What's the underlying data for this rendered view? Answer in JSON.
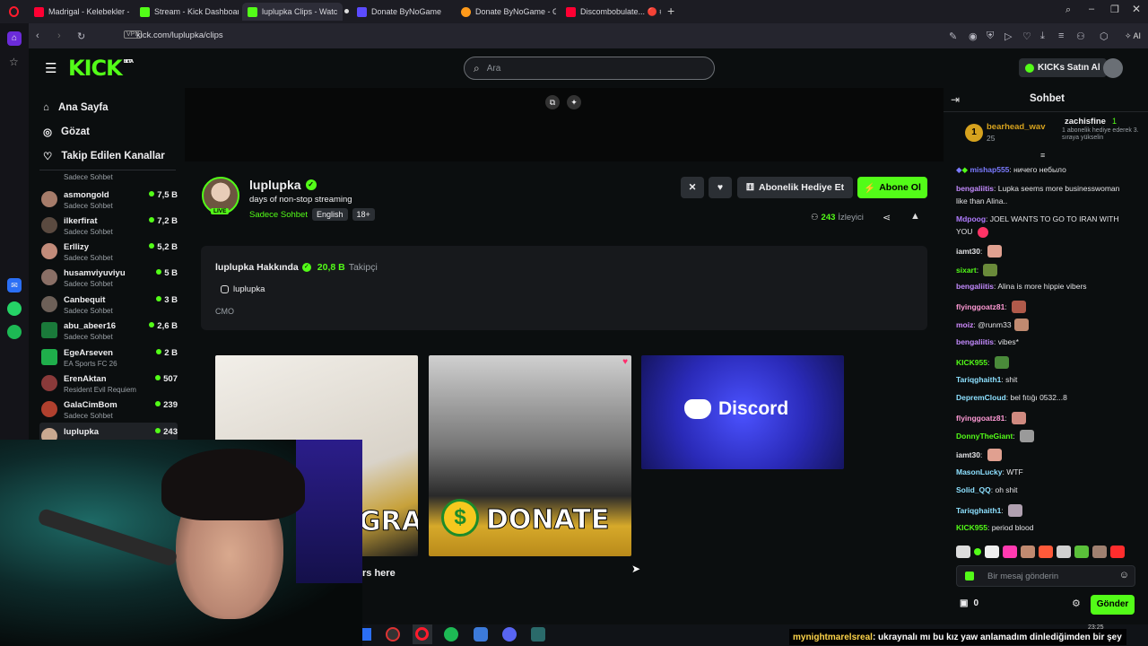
{
  "browser": {
    "tabs": [
      {
        "label": "Madrigal - Kelebekler - Yo",
        "icon": "youtube-icon",
        "color": "#ff0033"
      },
      {
        "label": "Stream - Kick Dashboard",
        "icon": "kick-icon",
        "color": "#53fc18"
      },
      {
        "label": "luplupka Clips - Watc",
        "icon": "kick-icon",
        "color": "#53fc18"
      },
      {
        "label": "Donate ByNoGame",
        "icon": "bynogame-icon",
        "color": "#5b4bff"
      },
      {
        "label": "Donate ByNoGame - Gele",
        "icon": "bynogame-icon",
        "color": "#ff9a1a"
      },
      {
        "label": "Discombobulate... 🔴 #Sh",
        "icon": "youtube-icon",
        "color": "#ff0033"
      }
    ],
    "vpn": "VPN",
    "url": "kick.com/luplupka/clips",
    "ai_label": "AI"
  },
  "kick": {
    "logo": "KICK",
    "beta": "BETA",
    "search_placeholder": "Ara",
    "kicks_button": "KICKs Satın Al",
    "nav": [
      "Ana Sayfa",
      "Gözat",
      "Takip Edilen Kanallar"
    ],
    "channels": [
      {
        "name": "",
        "category": "Sadece Sohbet",
        "viewers": "",
        "color": "#7b6a5a"
      },
      {
        "name": "asmongold",
        "category": "Sadece Sohbet",
        "viewers": "7,5 B",
        "color": "#a67c6a"
      },
      {
        "name": "ilkerfirat",
        "category": "Sadece Sohbet",
        "viewers": "7,2 B",
        "color": "#5a4a40"
      },
      {
        "name": "Erllizy",
        "category": "Sadece Sohbet",
        "viewers": "5,2 B",
        "color": "#c28b7a"
      },
      {
        "name": "husamviyuviyu",
        "category": "Sadece Sohbet",
        "viewers": "5 B",
        "color": "#8a6f66"
      },
      {
        "name": "Canbequit",
        "category": "Sadece Sohbet",
        "viewers": "3 B",
        "color": "#6d6058"
      },
      {
        "name": "abu_abeer16",
        "category": "Sadece Sohbet",
        "viewers": "2,6 B",
        "color": "#1a7a3a"
      },
      {
        "name": "EgeArseven",
        "category": "EA Sports FC 26",
        "viewers": "2 B",
        "color": "#1fae4b"
      },
      {
        "name": "ErenAktan",
        "category": "Resident Evil Requiem",
        "viewers": "507",
        "color": "#8a3a3a"
      },
      {
        "name": "GalaCimBom",
        "category": "Sadece Sohbet",
        "viewers": "239",
        "color": "#b0402e"
      },
      {
        "name": "luplupka",
        "category": "",
        "viewers": "243",
        "color": "#c9a890"
      }
    ],
    "streamer": {
      "name": "luplupka",
      "title": "days of non-stop streaming",
      "category": "Sadece Sohbet",
      "language": "English",
      "age": "18+",
      "live": "LIVE",
      "viewers": "243",
      "viewers_label": "İzleyici"
    },
    "buttons": {
      "gift": "Abonelik Hediye Et",
      "subscribe": "Abone Ol"
    },
    "about": {
      "title": "luplupka Hakkında",
      "followers": "20,8 B",
      "followers_label": "Takipçi",
      "instagram": "luplupka",
      "bio": "CMO"
    },
    "panels": {
      "discord": "Discord",
      "donate": "DONATE",
      "instagram_partial": "GRAM",
      "partial_text": "rs here"
    }
  },
  "chat": {
    "title": "Sohbet",
    "pinned": {
      "left_user": "bearhead_wav",
      "left_count": "25",
      "left_rank": "1",
      "right_user": "zachisfine",
      "right_count": "1",
      "right_note": "1 abonelik hediye ederek 3. sıraya yükselin"
    },
    "messages": [
      {
        "user": "mishap555",
        "color": "#7b7bff",
        "text": "ничего небыло"
      },
      {
        "user": "bengaliitis",
        "color": "#c48bff",
        "text": "Lupka seems more businesswoman"
      },
      {
        "user": "",
        "color": "#ffffff",
        "text": "like than Alina.."
      },
      {
        "user": "Mdpoog",
        "color": "#b07cff",
        "text": "JOEL WANTS TO GO TO IRAN WITH"
      },
      {
        "user": "",
        "color": "#ffffff",
        "text": "YOU"
      },
      {
        "user": "iamt30",
        "color": "#ffffff",
        "text": ""
      },
      {
        "user": "sixart",
        "color": "#53fc18",
        "text": ""
      },
      {
        "user": "bengaliitis",
        "color": "#c48bff",
        "text": "Alina is more hippie vibers"
      },
      {
        "user": "flyinggoatz81",
        "color": "#ff9ad5",
        "text": ""
      },
      {
        "user": "moiz",
        "color": "#d08aff",
        "text": "@runm33"
      },
      {
        "user": "bengaliitis",
        "color": "#c48bff",
        "text": "vibes*"
      },
      {
        "user": "KICK955",
        "color": "#53fc18",
        "text": ""
      },
      {
        "user": "Tariqghaith1",
        "color": "#8de0ff",
        "text": "shit"
      },
      {
        "user": "DepremCloud",
        "color": "#8de0ff",
        "text": "bel fıtığı 0532...8"
      },
      {
        "user": "flyinggoatz81",
        "color": "#ff9ad5",
        "text": ""
      },
      {
        "user": "DonnyTheGiant",
        "color": "#53fc18",
        "text": ""
      },
      {
        "user": "iamt30",
        "color": "#ffffff",
        "text": ""
      },
      {
        "user": "MasonLucky",
        "color": "#8de0ff",
        "text": "WTF"
      },
      {
        "user": "Solid_QQ",
        "color": "#8de0ff",
        "text": "oh shit"
      },
      {
        "user": "Tariqghaith1",
        "color": "#8de0ff",
        "text": ""
      },
      {
        "user": "KICK955",
        "color": "#53fc18",
        "text": "period blood"
      }
    ],
    "input_placeholder": "Bir mesaj gönderin",
    "points": "0",
    "send": "Gönder"
  },
  "overlay": {
    "ticker_user": "mynightmarelsreal",
    "ticker_text": ": ukraynalı mı bu kız yaw anlamadım dinlediğimden bir şey",
    "clock": "23:25"
  }
}
